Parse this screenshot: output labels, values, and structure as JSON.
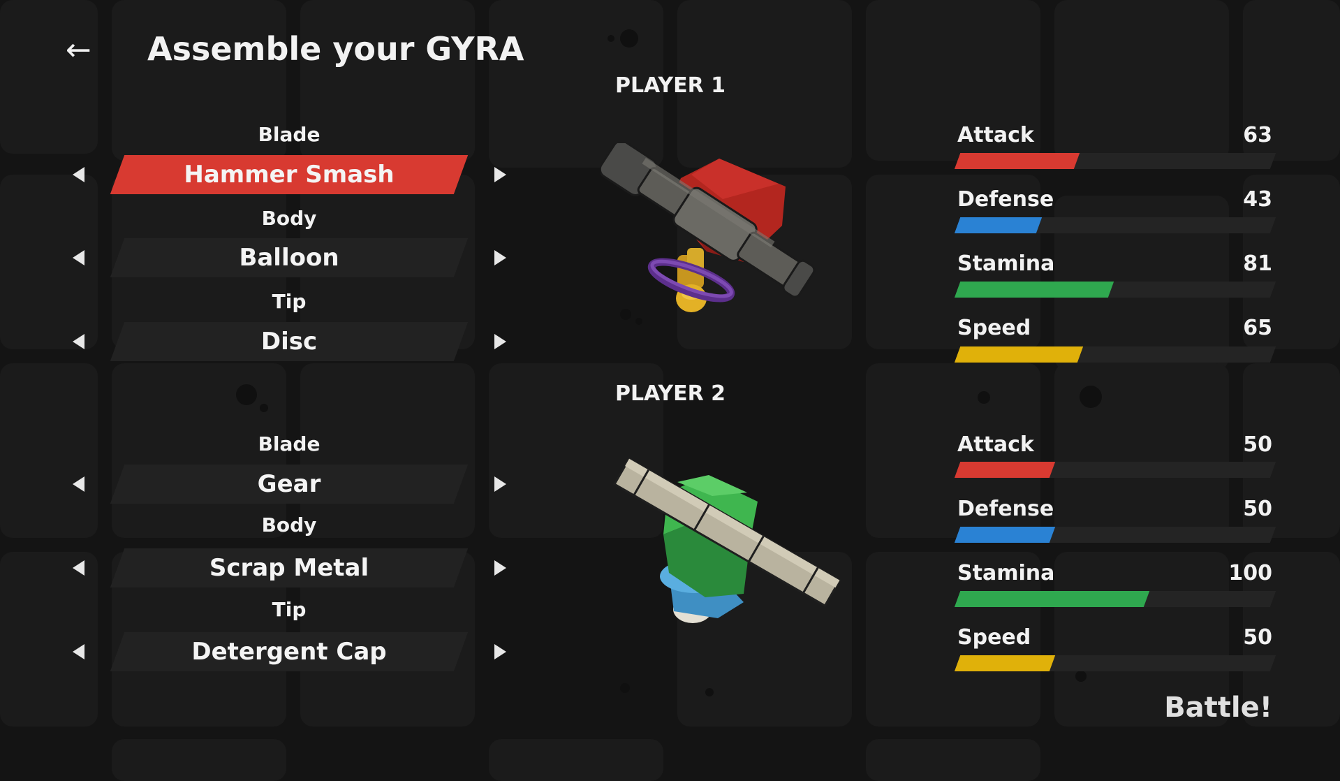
{
  "screen": {
    "title": "Assemble your GYRA",
    "back_icon": "←",
    "battle_label": "Battle!"
  },
  "colors": {
    "selected": "#d83a31",
    "attack": "#d83a31",
    "defense": "#2a82d4",
    "stamina": "#2fa84f",
    "speed": "#e0b10a"
  },
  "players": [
    {
      "title": "PLAYER 1",
      "parts": [
        {
          "label": "Blade",
          "value": "Hammer Smash",
          "selected": true
        },
        {
          "label": "Body",
          "value": "Balloon",
          "selected": false
        },
        {
          "label": "Tip",
          "value": "Disc",
          "selected": false
        }
      ],
      "stats": [
        {
          "name": "Attack",
          "value": 63
        },
        {
          "name": "Defense",
          "value": 43
        },
        {
          "name": "Stamina",
          "value": 81
        },
        {
          "name": "Speed",
          "value": 65
        }
      ]
    },
    {
      "title": "PLAYER 2",
      "parts": [
        {
          "label": "Blade",
          "value": "Gear",
          "selected": false
        },
        {
          "label": "Body",
          "value": "Scrap Metal",
          "selected": false
        },
        {
          "label": "Tip",
          "value": "Detergent Cap",
          "selected": false
        }
      ],
      "stats": [
        {
          "name": "Attack",
          "value": 50
        },
        {
          "name": "Defense",
          "value": 50
        },
        {
          "name": "Stamina",
          "value": 100
        },
        {
          "name": "Speed",
          "value": 50
        }
      ]
    }
  ]
}
